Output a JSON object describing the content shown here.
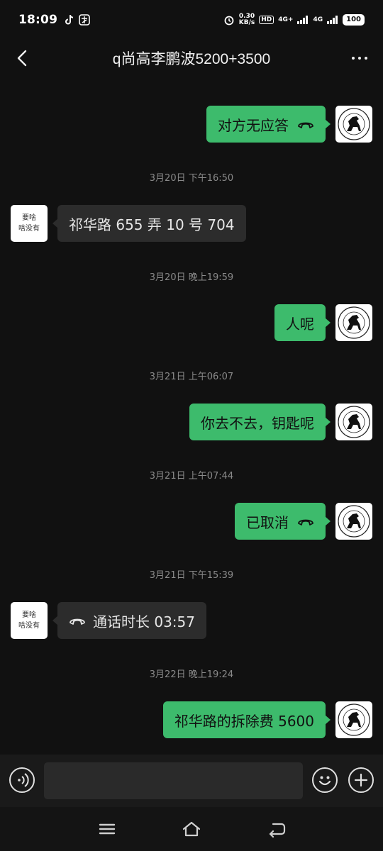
{
  "status_bar": {
    "time": "18:09",
    "net_speed_top": "0.30",
    "net_speed_bottom": "KB/s",
    "hd_label": "HD",
    "sig1": "4G+",
    "sig2": "4G",
    "battery": "100"
  },
  "header": {
    "title": "q尚高李鹏波5200+3500"
  },
  "avatar_other": {
    "line1": "要啥",
    "line2": "啥没有"
  },
  "messages": [
    {
      "from": "me",
      "text": "对方无应答",
      "call_icon": true
    },
    {
      "timestamp": "3月20日 下午16:50"
    },
    {
      "from": "other",
      "text": "祁华路 655 弄 10 号 704"
    },
    {
      "timestamp": "3月20日 晚上19:59"
    },
    {
      "from": "me",
      "text": "人呢"
    },
    {
      "timestamp": "3月21日 上午06:07"
    },
    {
      "from": "me",
      "text": "你去不去，钥匙呢"
    },
    {
      "timestamp": "3月21日 上午07:44"
    },
    {
      "from": "me",
      "text": "已取消",
      "call_icon": true
    },
    {
      "timestamp": "3月21日 下午15:39"
    },
    {
      "from": "other",
      "text": "通话时长 03:57",
      "call_icon": true
    },
    {
      "timestamp": "3月22日 晚上19:24"
    },
    {
      "from": "me",
      "text": "祁华路的拆除费 5600"
    }
  ],
  "input": {
    "value": ""
  },
  "colors": {
    "background": "#111111",
    "my_bubble": "#3dbb6c",
    "other_bubble": "#2c2c2c"
  }
}
